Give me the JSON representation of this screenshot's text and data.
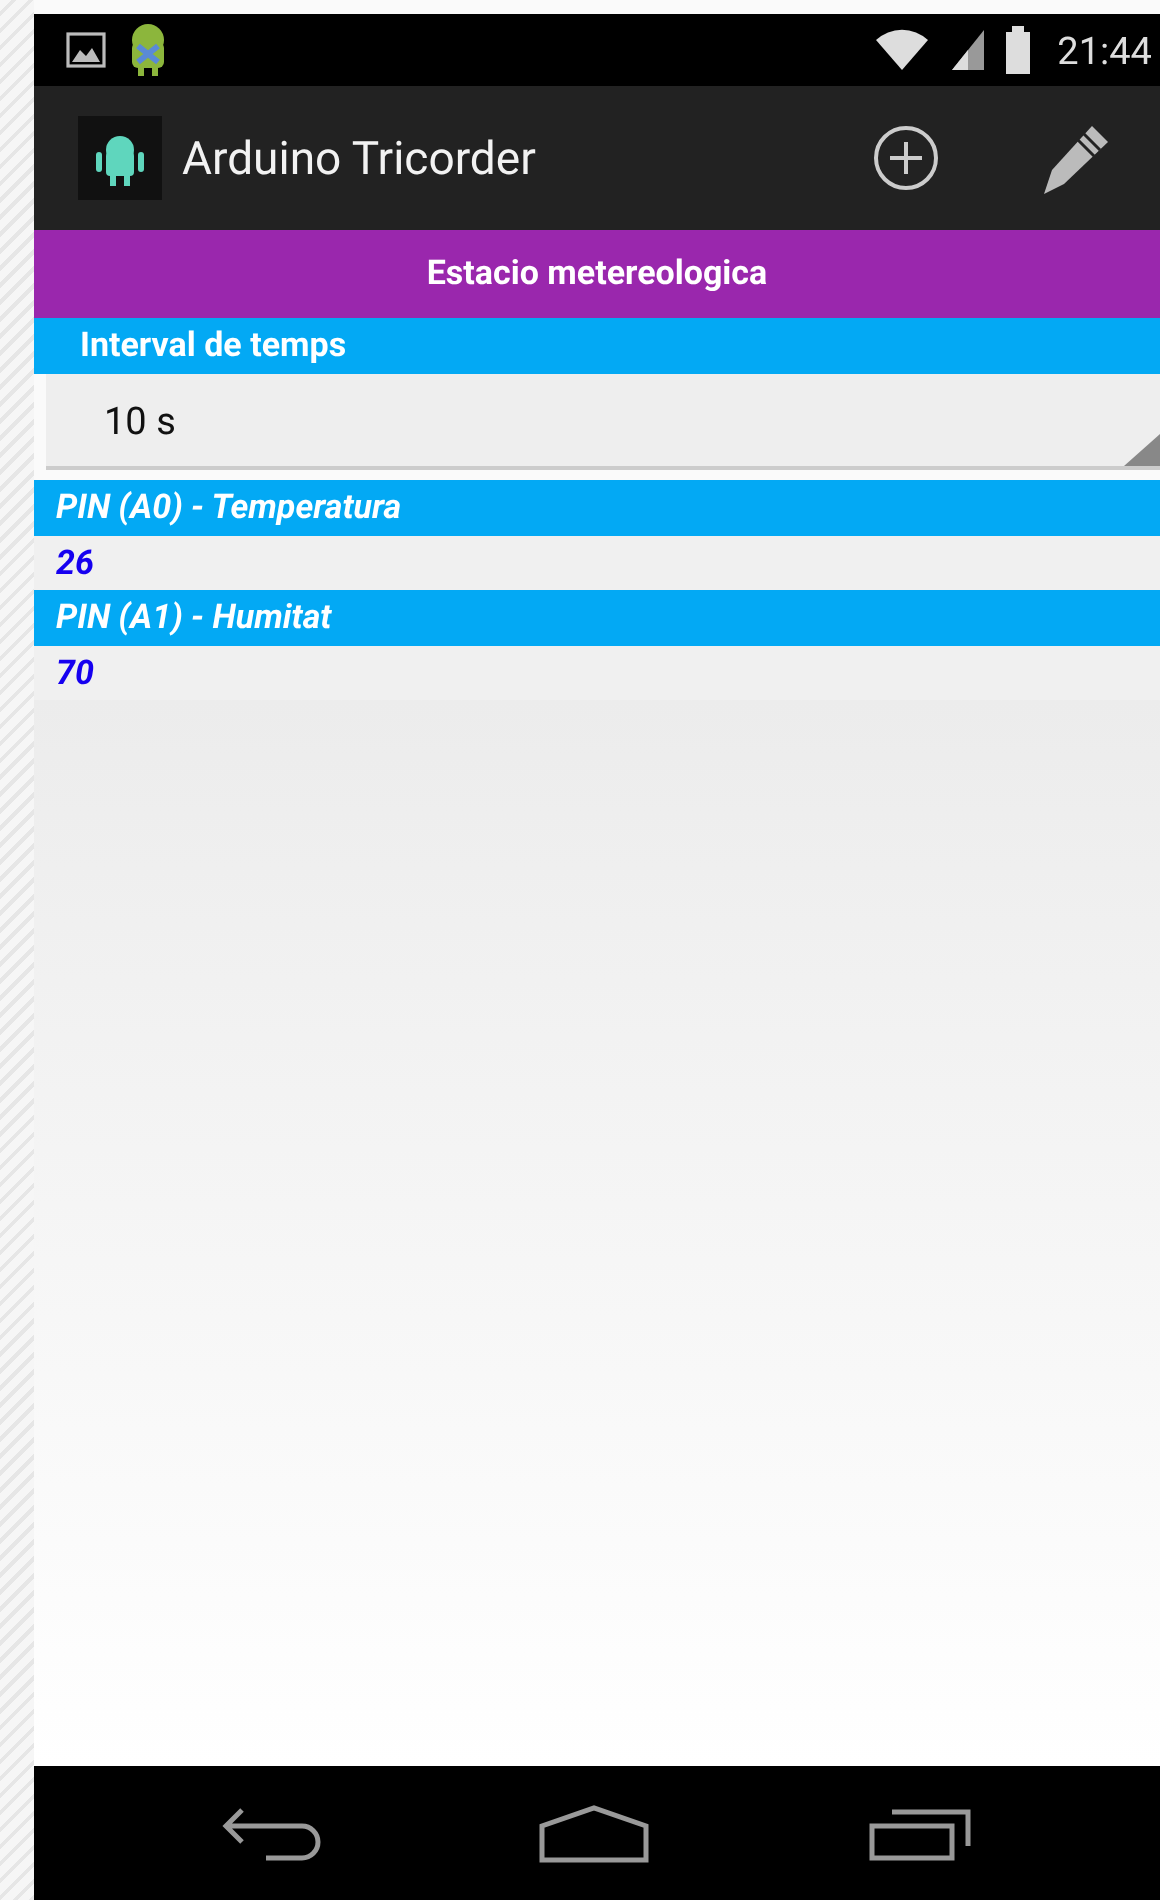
{
  "status_bar": {
    "time": "21:44"
  },
  "action_bar": {
    "title": "Arduino Tricorder"
  },
  "screen_title": "Estacio metereologica",
  "interval": {
    "label": "Interval de temps",
    "value": "10 s"
  },
  "pins": [
    {
      "label": "PIN (A0) - Temperatura",
      "value": "26"
    },
    {
      "label": "PIN (A1) - Humitat",
      "value": "70"
    }
  ]
}
